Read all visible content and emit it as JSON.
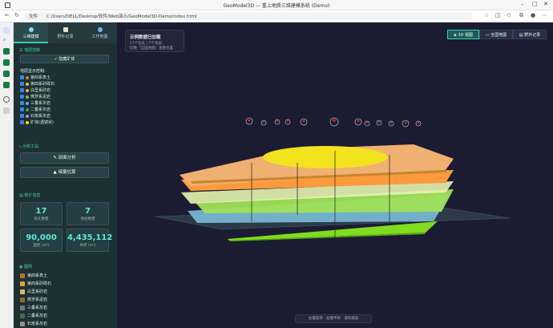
{
  "window": {
    "title": "GeoModel3D — 重上地质三维建模系统 (Demo)"
  },
  "address": {
    "label": "文件",
    "url": "C:/Users/DELL/Desktop/软件/Web演示/GeoModel3D-Demo/index.html"
  },
  "sidebar": {
    "tabs": [
      {
        "label": "三维建模"
      },
      {
        "label": "野外记录"
      },
      {
        "label": "工作地图"
      }
    ],
    "layer_section": "地层控制",
    "hide_button": "隐藏矿体",
    "layer_list_title": "地层显示控制:",
    "layers": [
      {
        "label": "第四系表土",
        "color": "#c8862f"
      },
      {
        "label": "第四系砂砾石",
        "color": "#e8c22a"
      },
      {
        "label": "白垩系砂岩",
        "color": "#e8a85a"
      },
      {
        "label": "侏罗系泥岩",
        "color": "#7cc44a"
      },
      {
        "label": "三叠系灰岩",
        "color": "#55b4e6"
      },
      {
        "label": "二叠系灰岩",
        "color": "#3fa35a"
      },
      {
        "label": "石炭系灰岩",
        "color": "#9aa0a6"
      },
      {
        "label": "矿体(透镜状)",
        "color": "#ffd51a"
      }
    ],
    "analysis_title": "分析工具",
    "analysis_buttons": [
      "剖面分析",
      "储量估算"
    ],
    "stats_title": "统计信息",
    "stats": [
      {
        "value": "17",
        "label": "钻孔数量"
      },
      {
        "value": "7",
        "label": "地层数量"
      },
      {
        "value": "90,000",
        "label": "面积 (m²)"
      },
      {
        "value": "4,435,112",
        "label": "体积 (m³)"
      }
    ],
    "legend_title": "图例",
    "legend": [
      {
        "label": "第四系表土",
        "color": "#b8752a"
      },
      {
        "label": "第四系砂砾石",
        "color": "#d9a72a"
      },
      {
        "label": "白垩系砂岩",
        "color": "#e0b860"
      },
      {
        "label": "侏罗系泥岩",
        "color": "#8a6a3a"
      },
      {
        "label": "三叠系灰岩",
        "color": "#6e7c8a"
      },
      {
        "label": "二叠系灰岩",
        "color": "#4e6a4e"
      },
      {
        "label": "石炭系灰岩",
        "color": "#8f8f8f"
      }
    ]
  },
  "viewport": {
    "info_title": "示例数据已加载",
    "info_line1": "17个钻孔 | 7个地层",
    "info_line2": "切换「全国地图」查看位置",
    "view_buttons": [
      "3D 视图",
      "全国地图",
      "野外记录"
    ],
    "hint": "左键旋转 · 右键平移 · 滚轮缩放"
  }
}
